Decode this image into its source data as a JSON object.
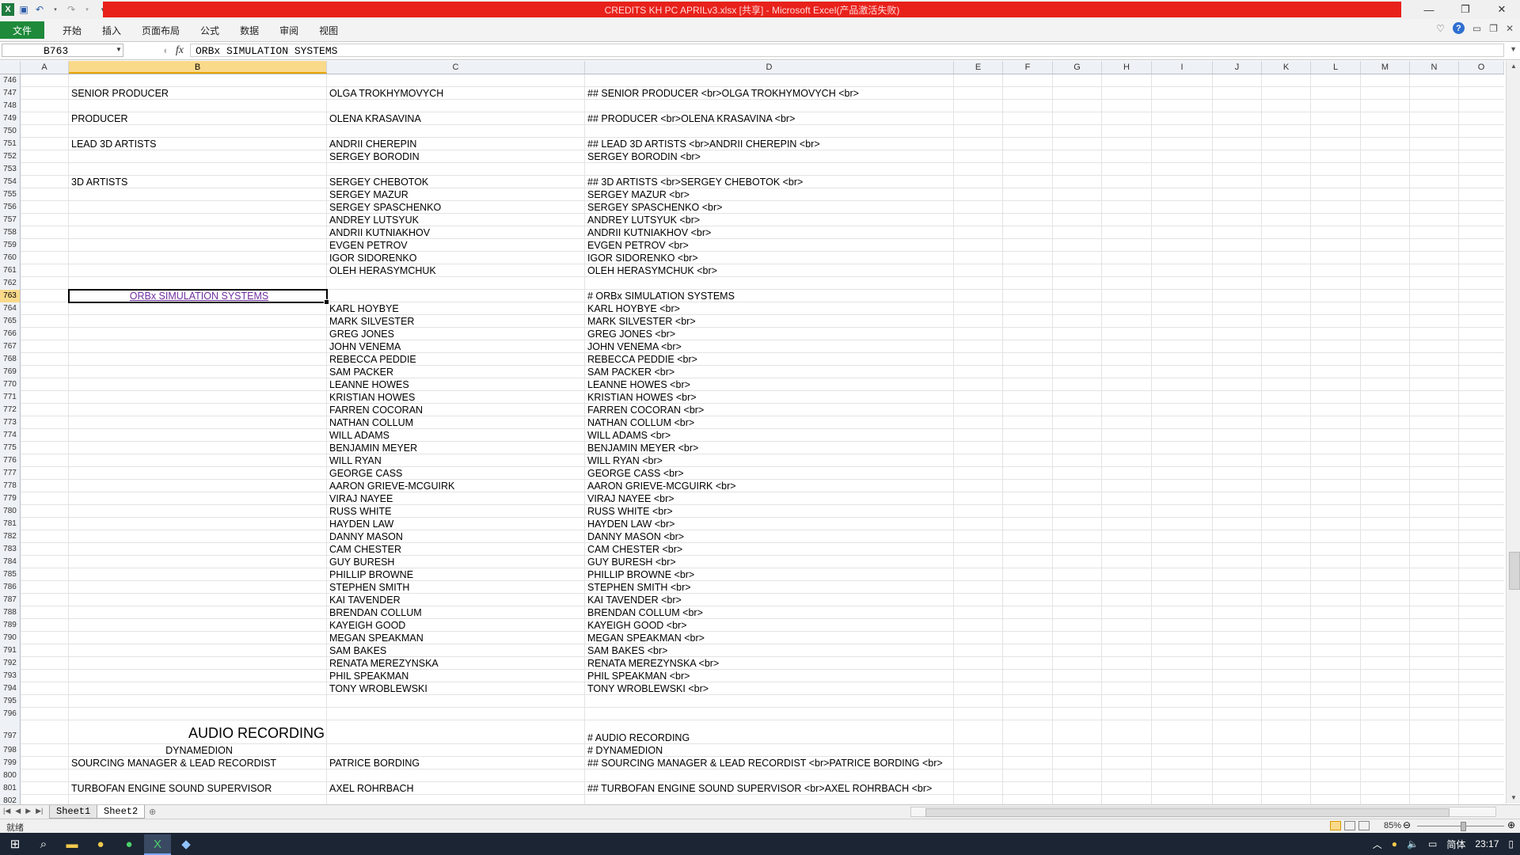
{
  "window": {
    "title": "CREDITS KH PC APRILv3.xlsx  [共享]  -  Microsoft Excel(产品激活失败)"
  },
  "ribbon": {
    "file_tab": "文件",
    "tabs": [
      "开始",
      "插入",
      "页面布局",
      "公式",
      "数据",
      "审阅",
      "视图"
    ]
  },
  "formula_bar": {
    "name_box": "B763",
    "fx": "fx",
    "content": "ORBx SIMULATION SYSTEMS"
  },
  "columns": [
    "A",
    "B",
    "C",
    "D",
    "E",
    "F",
    "G",
    "H",
    "I",
    "J",
    "K",
    "L",
    "M",
    "N",
    "O"
  ],
  "selected_column": "B",
  "selected_row": "763",
  "rows": [
    {
      "n": "746"
    },
    {
      "n": "747",
      "b": "SENIOR PRODUCER",
      "c": "OLGA TROKHYMOVYCH",
      "d": "## SENIOR PRODUCER <br>OLGA TROKHYMOVYCH <br>"
    },
    {
      "n": "748"
    },
    {
      "n": "749",
      "b": "PRODUCER",
      "c": "OLENA KRASAVINA",
      "d": "## PRODUCER <br>OLENA KRASAVINA <br>"
    },
    {
      "n": "750"
    },
    {
      "n": "751",
      "b": "LEAD 3D ARTISTS",
      "c": "ANDRII CHEREPIN",
      "d": "## LEAD 3D ARTISTS <br>ANDRII CHEREPIN <br>"
    },
    {
      "n": "752",
      "c": "SERGEY BORODIN",
      "d": "SERGEY BORODIN <br>"
    },
    {
      "n": "753"
    },
    {
      "n": "754",
      "b": "3D ARTISTS",
      "c": "SERGEY CHEBOTOK",
      "d": "## 3D ARTISTS <br>SERGEY CHEBOTOK <br>"
    },
    {
      "n": "755",
      "c": "SERGEY MAZUR",
      "d": "SERGEY MAZUR <br>"
    },
    {
      "n": "756",
      "c": "SERGEY SPASCHENKO",
      "d": "SERGEY SPASCHENKO <br>"
    },
    {
      "n": "757",
      "c": "ANDREY LUTSYUK",
      "d": "ANDREY LUTSYUK <br>"
    },
    {
      "n": "758",
      "c": "ANDRII KUTNIAKHOV",
      "d": "ANDRII KUTNIAKHOV <br>"
    },
    {
      "n": "759",
      "c": "EVGEN PETROV",
      "d": "EVGEN PETROV <br>"
    },
    {
      "n": "760",
      "c": "IGOR SIDORENKO",
      "d": "IGOR SIDORENKO <br>"
    },
    {
      "n": "761",
      "c": "OLEH HERASYMCHUK",
      "d": "OLEH HERASYMCHUK <br>"
    },
    {
      "n": "762"
    },
    {
      "n": "763",
      "b": "ORBx SIMULATION SYSTEMS",
      "d": "# ORBx SIMULATION SYSTEMS"
    },
    {
      "n": "764",
      "c": "KARL HOYBYE",
      "d": "KARL HOYBYE <br>"
    },
    {
      "n": "765",
      "c": "MARK SILVESTER",
      "d": "MARK SILVESTER <br>"
    },
    {
      "n": "766",
      "c": "GREG JONES",
      "d": "GREG JONES <br>"
    },
    {
      "n": "767",
      "c": "JOHN VENEMA",
      "d": "JOHN VENEMA <br>"
    },
    {
      "n": "768",
      "c": "REBECCA PEDDIE",
      "d": "REBECCA PEDDIE <br>"
    },
    {
      "n": "769",
      "c": "SAM PACKER",
      "d": "SAM PACKER <br>"
    },
    {
      "n": "770",
      "c": "LEANNE HOWES",
      "d": "LEANNE HOWES <br>"
    },
    {
      "n": "771",
      "c": "KRISTIAN HOWES",
      "d": "KRISTIAN HOWES <br>"
    },
    {
      "n": "772",
      "c": "FARREN COCORAN",
      "d": "FARREN COCORAN <br>"
    },
    {
      "n": "773",
      "c": "NATHAN COLLUM",
      "d": "NATHAN COLLUM <br>"
    },
    {
      "n": "774",
      "c": "WILL ADAMS",
      "d": "WILL ADAMS <br>"
    },
    {
      "n": "775",
      "c": "BENJAMIN MEYER",
      "d": "BENJAMIN MEYER <br>"
    },
    {
      "n": "776",
      "c": "WILL RYAN",
      "d": "WILL RYAN <br>"
    },
    {
      "n": "777",
      "c": "GEORGE CASS",
      "d": "GEORGE CASS <br>"
    },
    {
      "n": "778",
      "c": "AARON GRIEVE-MCGUIRK",
      "d": "AARON GRIEVE-MCGUIRK <br>"
    },
    {
      "n": "779",
      "c": "VIRAJ NAYEE",
      "d": "VIRAJ NAYEE <br>"
    },
    {
      "n": "780",
      "c": "RUSS WHITE",
      "d": "RUSS WHITE <br>"
    },
    {
      "n": "781",
      "c": "HAYDEN LAW",
      "d": "HAYDEN LAW <br>"
    },
    {
      "n": "782",
      "c": "DANNY MASON",
      "d": "DANNY MASON <br>"
    },
    {
      "n": "783",
      "c": "CAM CHESTER",
      "d": "CAM CHESTER <br>"
    },
    {
      "n": "784",
      "c": "GUY BURESH",
      "d": "GUY BURESH <br>"
    },
    {
      "n": "785",
      "c": "PHILLIP BROWNE",
      "d": "PHILLIP BROWNE <br>"
    },
    {
      "n": "786",
      "c": "STEPHEN SMITH",
      "d": "STEPHEN SMITH <br>"
    },
    {
      "n": "787",
      "c": "KAI TAVENDER",
      "d": "KAI TAVENDER <br>"
    },
    {
      "n": "788",
      "c": "BRENDAN COLLUM",
      "d": "BRENDAN COLLUM <br>"
    },
    {
      "n": "789",
      "c": "KAYEIGH GOOD",
      "d": "KAYEIGH GOOD <br>"
    },
    {
      "n": "790",
      "c": "MEGAN SPEAKMAN",
      "d": "MEGAN SPEAKMAN <br>"
    },
    {
      "n": "791",
      "c": "SAM BAKES",
      "d": "SAM BAKES <br>"
    },
    {
      "n": "792",
      "c": "RENATA MEREZYNSKA",
      "d": "RENATA MEREZYNSKA <br>"
    },
    {
      "n": "793",
      "c": "PHIL SPEAKMAN",
      "d": "PHIL SPEAKMAN <br>"
    },
    {
      "n": "794",
      "c": "TONY WROBLEWSKI",
      "d": "TONY WROBLEWSKI <br>"
    },
    {
      "n": "795"
    },
    {
      "n": "796"
    },
    {
      "n": "797",
      "b": "AUDIO RECORDING",
      "d": "# AUDIO RECORDING"
    },
    {
      "n": "798",
      "b": "DYNAMEDION",
      "d": "# DYNAMEDION"
    },
    {
      "n": "799",
      "b": "SOURCING MANAGER & LEAD RECORDIST",
      "c": "PATRICE BORDING",
      "d": "## SOURCING MANAGER & LEAD RECORDIST <br>PATRICE BORDING <br>"
    },
    {
      "n": "800"
    },
    {
      "n": "801",
      "b": "TURBOFAN ENGINE SOUND SUPERVISOR",
      "c": "AXEL ROHRBACH",
      "d": "## TURBOFAN ENGINE SOUND SUPERVISOR <br>AXEL ROHRBACH  <br>"
    },
    {
      "n": "802"
    }
  ],
  "sheet_tabs": [
    "Sheet1",
    "Sheet2"
  ],
  "active_sheet": "Sheet2",
  "status": {
    "ready": "就绪",
    "zoom": "85%"
  },
  "taskbar": {
    "ime": "简体",
    "time": "23:17"
  }
}
